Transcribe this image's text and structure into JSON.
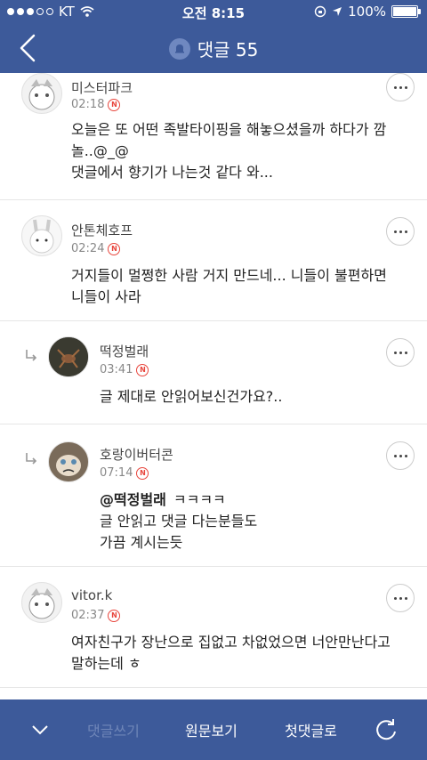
{
  "status": {
    "carrier": "KT",
    "time": "오전 8:15",
    "battery": "100%",
    "battery_level": 1.0
  },
  "header": {
    "title": "댓글 55"
  },
  "comments": [
    {
      "author": "미스터파크",
      "time": "02:18",
      "badge": "N",
      "lines": [
        "오늘은 또 어떤 족발타이핑을 해놓으셨을까 하다가 깜",
        "놀..@_@",
        "댓글에서 향기가 나는것 같다 와..."
      ]
    },
    {
      "author": "안톤체호프",
      "time": "02:24",
      "badge": "N",
      "lines": [
        "거지들이 멀쩡한 사람 거지 만드네... 니들이 불편하면",
        "니들이 사라"
      ]
    },
    {
      "author": "떡정벌래",
      "time": "03:41",
      "badge": "N",
      "lines": [
        "글 제대로 안읽어보신건가요?.."
      ]
    },
    {
      "author": "호랑이버터콘",
      "time": "07:14",
      "badge": "N",
      "mention": "@떡정벌래",
      "first_line": "ㅋㅋㅋㅋ",
      "lines": [
        "글 안읽고 댓글 다는분들도",
        "가끔 계시는듯"
      ]
    },
    {
      "author": "vitor.k",
      "time": "02:37",
      "badge": "N",
      "lines": [
        "여자친구가 장난으로 집없고 차없었으면 너안만난다고",
        "말하는데 ㅎ"
      ]
    }
  ],
  "bottom": {
    "write": "댓글쓰기",
    "original": "원문보기",
    "first": "첫댓글로"
  }
}
